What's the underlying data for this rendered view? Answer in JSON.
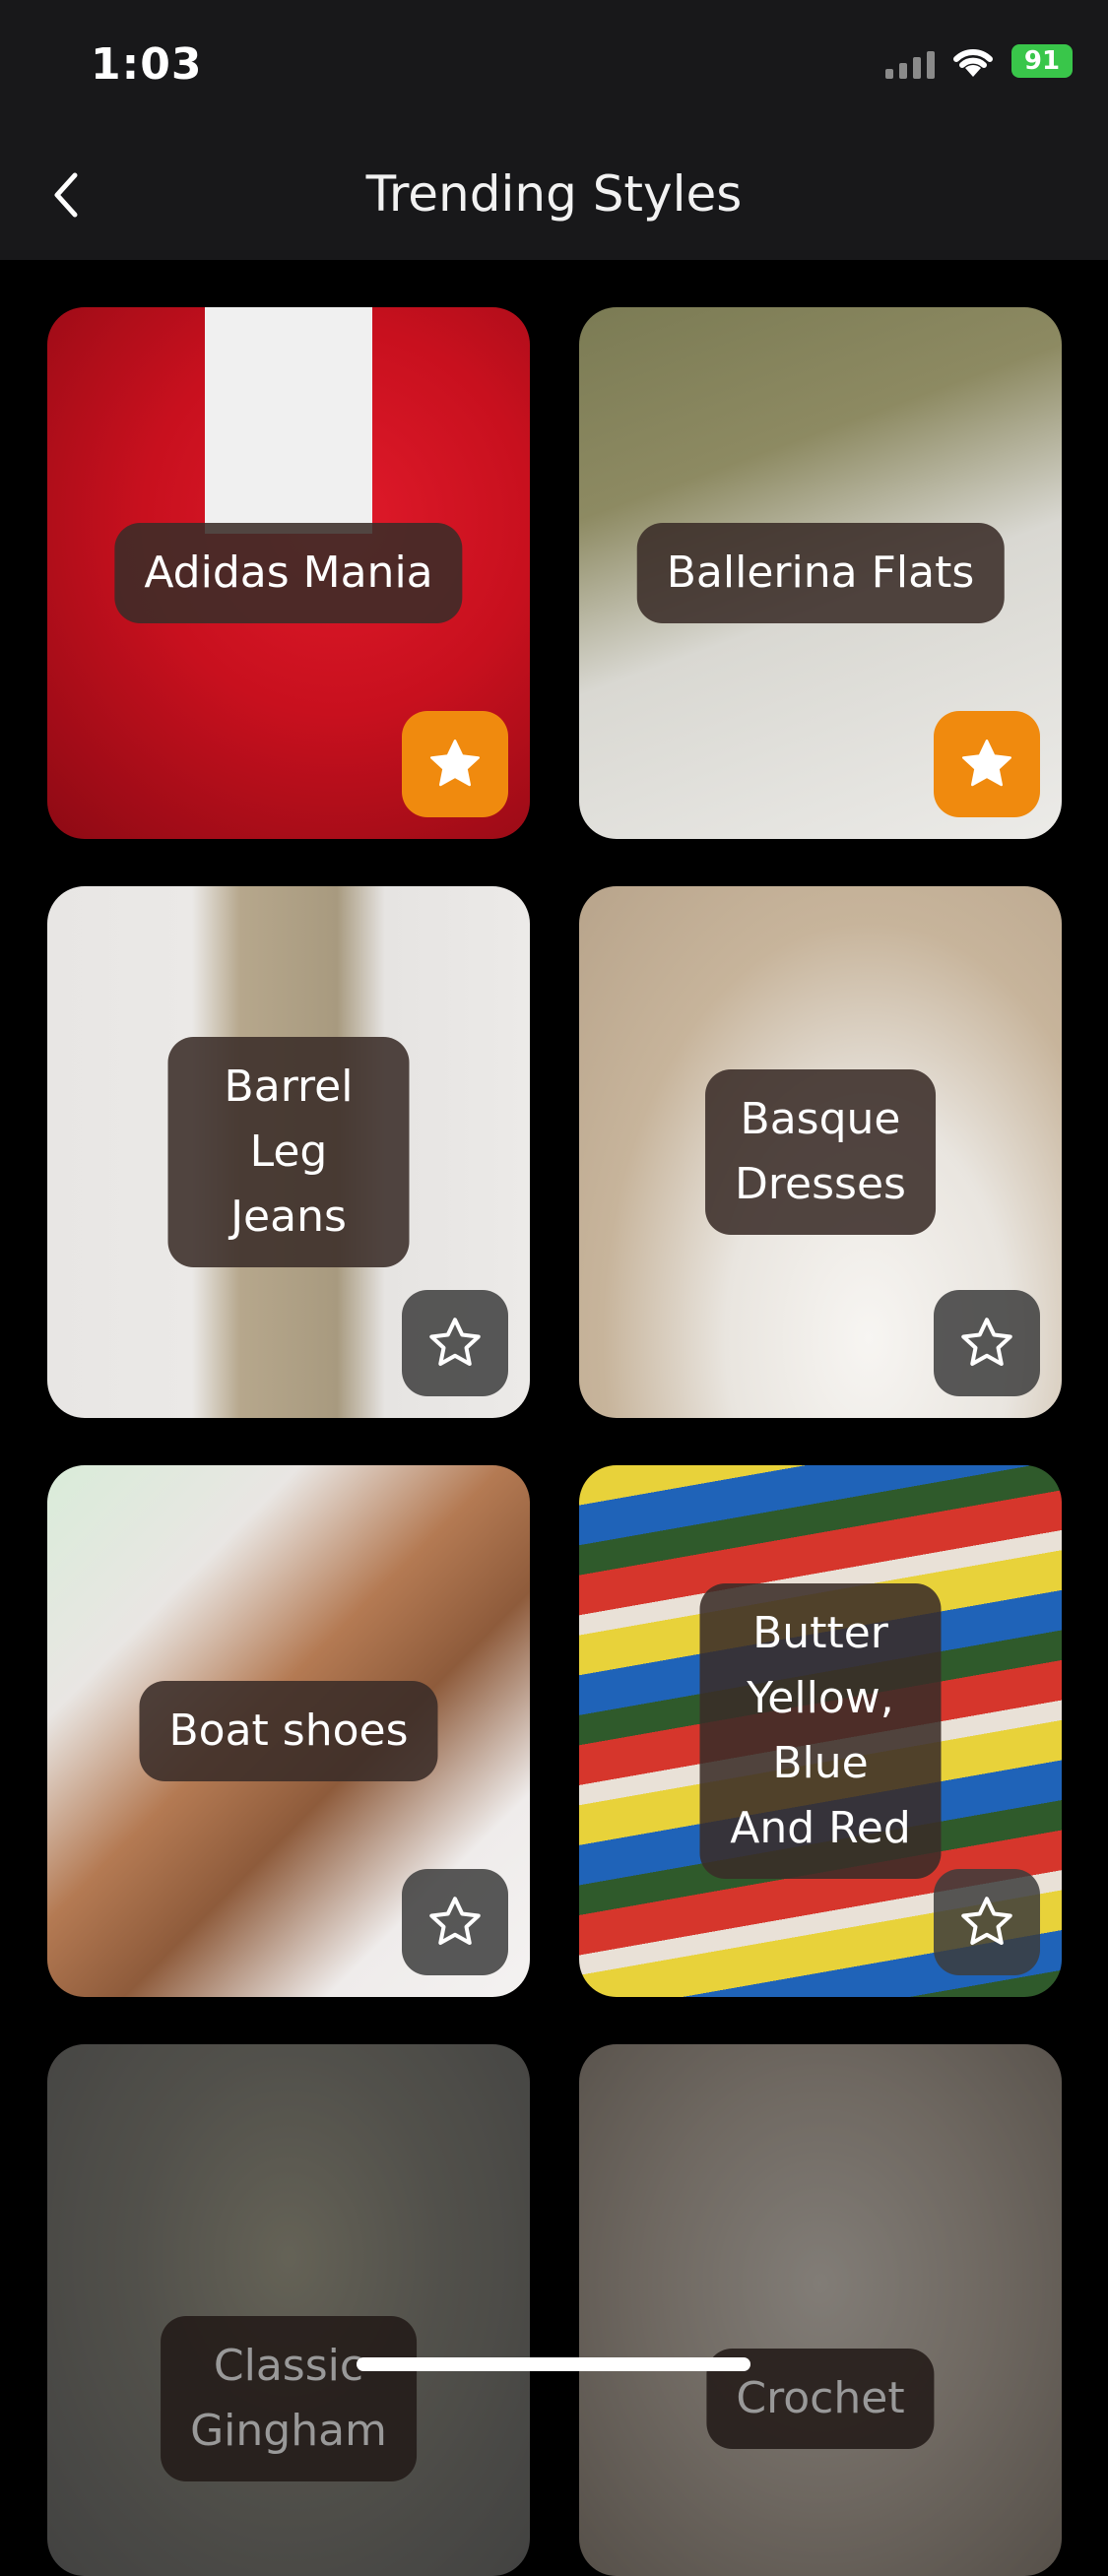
{
  "status": {
    "time": "1:03",
    "battery": "91"
  },
  "nav": {
    "title": "Trending Styles"
  },
  "styles": [
    {
      "name": "Adidas Mania",
      "favorited": true
    },
    {
      "name": "Ballerina Flats",
      "favorited": true
    },
    {
      "name": "Barrel\nLeg Jeans",
      "favorited": false
    },
    {
      "name": "Basque\nDresses",
      "favorited": false
    },
    {
      "name": "Boat shoes",
      "favorited": false
    },
    {
      "name": "Butter Yellow,\nBlue And Red",
      "favorited": false
    },
    {
      "name": "Classic\nGingham",
      "favorited": false
    },
    {
      "name": "Crochet",
      "favorited": false
    }
  ],
  "colors": {
    "accent": "#f08a0e",
    "bar": "#18181a",
    "pill": "#3a2c28"
  }
}
